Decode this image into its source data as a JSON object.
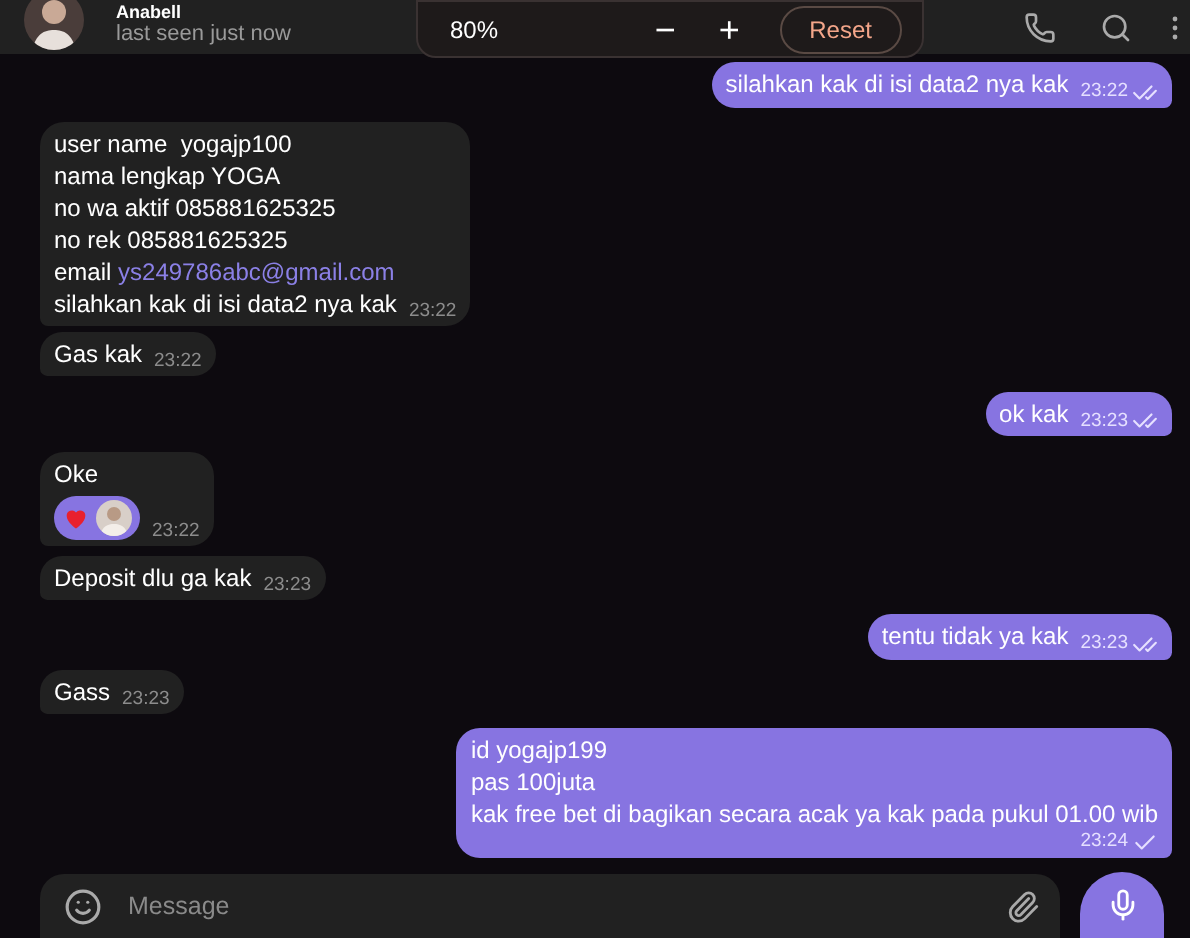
{
  "header": {
    "name": "Anabell",
    "status": "last seen just now"
  },
  "zoom": {
    "percent": "80%",
    "minus": "−",
    "plus": "+",
    "reset": "Reset"
  },
  "messages": [
    {
      "kind": "outgoing",
      "lines": [
        {
          "text": "silahkan kak di isi data2 nya kak"
        }
      ],
      "time": "23:22",
      "read": true
    },
    {
      "kind": "incoming",
      "lines": [
        {
          "text": "user name  yogajp100"
        },
        {
          "text": "nama lengkap YOGA"
        },
        {
          "text": "no wa aktif 085881625325"
        },
        {
          "text": "no rek 085881625325"
        },
        {
          "text": "email",
          "link": "ys249786abc@gmail.com"
        },
        {
          "text": "silahkan kak di isi data2 nya kak"
        }
      ],
      "time": "23:22"
    },
    {
      "kind": "incoming",
      "lines": [
        {
          "text": "Gas kak"
        }
      ],
      "time": "23:22"
    },
    {
      "kind": "outgoing",
      "lines": [
        {
          "text": "ok kak"
        }
      ],
      "time": "23:23",
      "read": true
    },
    {
      "kind": "incoming",
      "lines": [
        {
          "text": "Oke"
        }
      ],
      "time": "23:22",
      "reactions": [
        {
          "kind": "heart"
        },
        {
          "kind": "avatar"
        }
      ]
    },
    {
      "kind": "incoming",
      "lines": [
        {
          "text": "Deposit dlu ga kak"
        }
      ],
      "time": "23:23"
    },
    {
      "kind": "outgoing",
      "lines": [
        {
          "text": "tentu tidak ya kak"
        }
      ],
      "time": "23:23",
      "read": true
    },
    {
      "kind": "incoming",
      "lines": [
        {
          "text": "Gass"
        }
      ],
      "time": "23:23"
    },
    {
      "kind": "outgoing",
      "lines": [
        {
          "text": "id yogajp199"
        },
        {
          "text": "pas 100juta"
        },
        {
          "text": "kak free bet di bagikan secara acak ya kak pada pukul 01.00 wib"
        }
      ],
      "time": "23:24",
      "read": false
    }
  ],
  "composer": {
    "placeholder": "Message"
  }
}
